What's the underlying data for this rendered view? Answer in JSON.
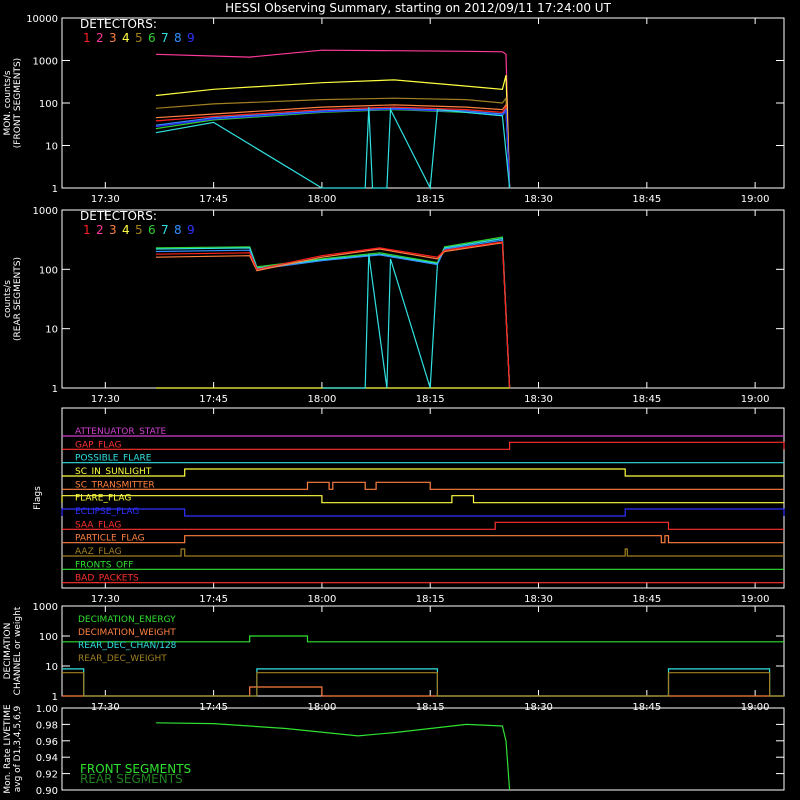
{
  "title": "HESSI Observing Summary, starting on 2012/09/11 17:24:00 UT",
  "colors": {
    "det1": "#ff2020",
    "det2": "#ff3a9a",
    "det3": "#ff8040",
    "det4": "#ffff40",
    "det5": "#a08020",
    "det6": "#30d030",
    "det7": "#30e0e0",
    "det8": "#3090ff",
    "det9": "#3030ff",
    "magenta": "#d040d0",
    "red": "#ff3030",
    "cyan": "#30e0e0",
    "yellow": "#ffff40",
    "orange": "#ff8040",
    "blue": "#3030ff",
    "olive": "#a08020",
    "green": "#30e030"
  },
  "time_ticks": [
    "17:30",
    "17:45",
    "18:00",
    "18:15",
    "18:30",
    "18:45",
    "19:00"
  ],
  "chart_data": [
    {
      "type": "line",
      "id": "front",
      "ylabel": "MON. counts/s",
      "ylabel2": "(FRONT SEGMENTS)",
      "yscale": "log",
      "ylim": [
        1,
        10000
      ],
      "ytick_labels": [
        "1",
        "10",
        "100",
        "1000",
        "10000"
      ],
      "xlim": [
        "17:24",
        "19:04"
      ],
      "legend_title": "DETECTORS:",
      "legend_items": [
        "1",
        "2",
        "3",
        "4",
        "5",
        "6",
        "7",
        "8",
        "9"
      ],
      "series": [
        {
          "color_key": "det2",
          "x": [
            "17:37",
            "17:50",
            "18:00",
            "18:10",
            "18:20",
            "18:25",
            "18:25.5",
            "18:26"
          ],
          "values": [
            1400,
            1200,
            1750,
            1700,
            1650,
            1600,
            1400,
            1
          ]
        },
        {
          "color_key": "det4",
          "x": [
            "17:37",
            "17:45",
            "18:00",
            "18:10",
            "18:20",
            "18:25",
            "18:25.5",
            "18:26"
          ],
          "values": [
            150,
            210,
            300,
            350,
            250,
            210,
            450,
            1
          ]
        },
        {
          "color_key": "det5",
          "x": [
            "17:37",
            "17:45",
            "18:00",
            "18:10",
            "18:20",
            "18:25",
            "18:25.5",
            "18:26"
          ],
          "values": [
            75,
            95,
            120,
            130,
            120,
            100,
            130,
            1
          ]
        },
        {
          "color_key": "det3",
          "x": [
            "17:37",
            "17:45",
            "18:00",
            "18:10",
            "18:20",
            "18:25",
            "18:25.5",
            "18:26"
          ],
          "values": [
            45,
            55,
            80,
            90,
            80,
            70,
            90,
            1
          ]
        },
        {
          "color_key": "det1",
          "x": [
            "17:37",
            "17:45",
            "18:00",
            "18:10",
            "18:20",
            "18:25",
            "18:25.5",
            "18:26"
          ],
          "values": [
            38,
            48,
            70,
            80,
            70,
            60,
            80,
            1
          ]
        },
        {
          "color_key": "det8",
          "x": [
            "17:37",
            "17:45",
            "18:00",
            "18:10",
            "18:20",
            "18:25",
            "18:25.5",
            "18:26"
          ],
          "values": [
            30,
            45,
            65,
            75,
            65,
            55,
            70,
            1
          ]
        },
        {
          "color_key": "det6",
          "x": [
            "17:37",
            "17:45",
            "18:00",
            "18:10",
            "18:20",
            "18:25",
            "18:25.5",
            "18:26"
          ],
          "values": [
            25,
            40,
            60,
            70,
            60,
            50,
            65,
            1
          ]
        },
        {
          "color_key": "det9",
          "x": [
            "17:37",
            "17:45",
            "18:00",
            "18:10",
            "18:20",
            "18:25",
            "18:25.5",
            "18:26"
          ],
          "values": [
            28,
            42,
            62,
            72,
            62,
            52,
            66,
            1
          ]
        },
        {
          "color_key": "det7",
          "x": [
            "17:37",
            "17:45",
            "18:00",
            "18:00.1",
            "18:06",
            "18:06.5",
            "18:07",
            "18:09",
            "18:09.5",
            "18:15",
            "18:16",
            "18:25",
            "18:26"
          ],
          "values": [
            20,
            35,
            1,
            1,
            1,
            80,
            1,
            1,
            70,
            1,
            70,
            50,
            1
          ]
        }
      ]
    },
    {
      "type": "line",
      "id": "rear",
      "ylabel": "counts/s",
      "ylabel2": "(REAR SEGMENTS)",
      "yscale": "log",
      "ylim": [
        1,
        1000
      ],
      "ytick_labels": [
        "1",
        "10",
        "100",
        "1000"
      ],
      "xlim": [
        "17:24",
        "19:04"
      ],
      "legend_title": "DETECTORS:",
      "legend_items": [
        "1",
        "2",
        "3",
        "4",
        "5",
        "6",
        "7",
        "8",
        "9"
      ],
      "series": [
        {
          "color_key": "det6",
          "x": [
            "17:37",
            "17:50",
            "17:51",
            "18:00",
            "18:08",
            "18:16",
            "18:17",
            "18:25",
            "18:26"
          ],
          "values": [
            230,
            240,
            110,
            150,
            190,
            130,
            240,
            350,
            1
          ]
        },
        {
          "color_key": "det7",
          "x": [
            "17:37",
            "17:50",
            "17:51",
            "18:00",
            "18:08",
            "18:16",
            "18:17",
            "18:25",
            "18:26"
          ],
          "values": [
            220,
            230,
            105,
            145,
            180,
            125,
            230,
            330,
            1
          ]
        },
        {
          "color_key": "det8",
          "x": [
            "17:37",
            "17:50",
            "17:51",
            "18:00",
            "18:08",
            "18:16",
            "18:17",
            "18:25",
            "18:26"
          ],
          "values": [
            200,
            210,
            100,
            140,
            175,
            120,
            220,
            310,
            1
          ]
        },
        {
          "color_key": "det3",
          "x": [
            "17:37",
            "17:50",
            "17:51",
            "18:00",
            "18:08",
            "18:16",
            "18:17",
            "18:25",
            "18:26"
          ],
          "values": [
            160,
            170,
            95,
            160,
            220,
            150,
            200,
            280,
            1
          ]
        },
        {
          "color_key": "det1",
          "x": [
            "17:37",
            "17:50",
            "17:51",
            "18:00",
            "18:08",
            "18:16",
            "18:17",
            "18:25",
            "18:26"
          ],
          "values": [
            180,
            190,
            100,
            170,
            230,
            160,
            210,
            290,
            1
          ]
        },
        {
          "color_key": "det4",
          "x": [
            "17:37",
            "18:26"
          ],
          "values": [
            1,
            1
          ]
        },
        {
          "color_key": "det7",
          "x": [
            "18:00.1",
            "18:06",
            "18:06.5",
            "18:09",
            "18:09.5",
            "18:15",
            "18:16"
          ],
          "values": [
            1,
            1,
            180,
            1,
            150,
            1,
            120
          ]
        }
      ]
    },
    {
      "type": "step",
      "id": "flags",
      "ylabel": "Flags",
      "xlim": [
        "17:24",
        "19:04"
      ],
      "flags": [
        {
          "label": "ATTENUATOR_STATE",
          "color_key": "magenta",
          "segments": []
        },
        {
          "label": "GAP_FLAG",
          "color_key": "red",
          "segments": [
            [
              "18:26",
              "19:04"
            ]
          ]
        },
        {
          "label": "POSSIBLE_FLARE",
          "color_key": "cyan",
          "segments": []
        },
        {
          "label": "SC_IN_SUNLIGHT",
          "color_key": "yellow",
          "segments": [
            [
              "17:41",
              "18:42"
            ]
          ]
        },
        {
          "label": "SC_TRANSMITTER",
          "color_key": "orange",
          "segments": [
            [
              "17:58",
              "18:01"
            ],
            [
              "18:01.5",
              "18:06"
            ],
            [
              "18:07.5",
              "18:15"
            ]
          ]
        },
        {
          "label": "FLARE_FLAG",
          "color_key": "yellow",
          "segments": [
            [
              "17:24",
              "18:00"
            ],
            [
              "18:18",
              "18:21"
            ]
          ]
        },
        {
          "label": "ECLIPSE_FLAG",
          "color_key": "blue",
          "segments": [
            [
              "17:24",
              "17:41"
            ],
            [
              "18:42",
              "19:04"
            ]
          ]
        },
        {
          "label": "SAA_FLAG",
          "color_key": "red",
          "segments": [
            [
              "18:24",
              "18:48"
            ]
          ]
        },
        {
          "label": "PARTICLE_FLAG",
          "color_key": "orange",
          "segments": [
            [
              "17:41",
              "18:47"
            ],
            [
              "18:47.5",
              "18:48"
            ]
          ]
        },
        {
          "label": "AAZ_FLAG",
          "color_key": "olive",
          "segments": [
            [
              "17:40.5",
              "17:41"
            ],
            [
              "18:42",
              "18:42.3"
            ]
          ]
        },
        {
          "label": "FRONTS_OFF",
          "color_key": "green",
          "segments": []
        },
        {
          "label": "BAD_PACKETS",
          "color_key": "red",
          "segments": []
        }
      ]
    },
    {
      "type": "step",
      "id": "decimation",
      "ylabel": "DECIMATION",
      "ylabel2": "CHANNEL or weight",
      "yscale": "log",
      "ylim": [
        1,
        1000
      ],
      "ytick_labels": [
        "1",
        "10",
        "100",
        "1000"
      ],
      "xlim": [
        "17:24",
        "19:04"
      ],
      "legend_items": [
        "DECIMATION_ENERGY",
        "DECIMATION_WEIGHT",
        "REAR_DEC_CHAN/128",
        "REAR_DEC_WEIGHT"
      ],
      "series": [
        {
          "color_key": "green",
          "x": [
            "17:24",
            "17:50",
            "17:50",
            "17:58",
            "17:58",
            "19:04"
          ],
          "values": [
            64,
            64,
            100,
            100,
            64,
            64
          ]
        },
        {
          "color_key": "orange",
          "x": [
            "17:24",
            "17:50",
            "17:50",
            "18:00",
            "18:00",
            "19:04"
          ],
          "values": [
            1,
            1,
            2,
            2,
            1,
            1
          ]
        },
        {
          "color_key": "cyan",
          "x": [
            "17:24",
            "17:27",
            "17:27",
            "17:51",
            "17:51",
            "18:16",
            "18:16",
            "18:48",
            "18:48",
            "19:02",
            "19:02",
            "19:04"
          ],
          "values": [
            8,
            8,
            1,
            1,
            8,
            8,
            1,
            1,
            8,
            8,
            1,
            1
          ]
        },
        {
          "color_key": "olive",
          "x": [
            "17:24",
            "17:27",
            "17:27",
            "17:51",
            "17:51",
            "18:16",
            "18:16",
            "18:48",
            "18:48",
            "19:02",
            "19:02",
            "19:04"
          ],
          "values": [
            6,
            6,
            1,
            1,
            6,
            6,
            1,
            1,
            6,
            6,
            1,
            1
          ]
        }
      ]
    },
    {
      "type": "line",
      "id": "livetime",
      "ylabel": "Mon. Rate LIVETIME",
      "ylabel2": "avg of D1,3,4,5,6,9",
      "ylim": [
        0.9,
        1.0
      ],
      "ytick_labels": [
        "0.90",
        "0.92",
        "0.94",
        "0.96",
        "0.98",
        "1.00"
      ],
      "xlim": [
        "17:24",
        "19:04"
      ],
      "legend_items": [
        "FRONT SEGMENTS",
        "REAR SEGMENTS"
      ],
      "series": [
        {
          "color_key": "green",
          "x": [
            "17:37",
            "17:45",
            "17:55",
            "18:05",
            "18:10",
            "18:20",
            "18:25",
            "18:25.5",
            "18:26"
          ],
          "values": [
            0.982,
            0.981,
            0.975,
            0.966,
            0.97,
            0.98,
            0.978,
            0.96,
            0.9
          ]
        }
      ]
    }
  ]
}
